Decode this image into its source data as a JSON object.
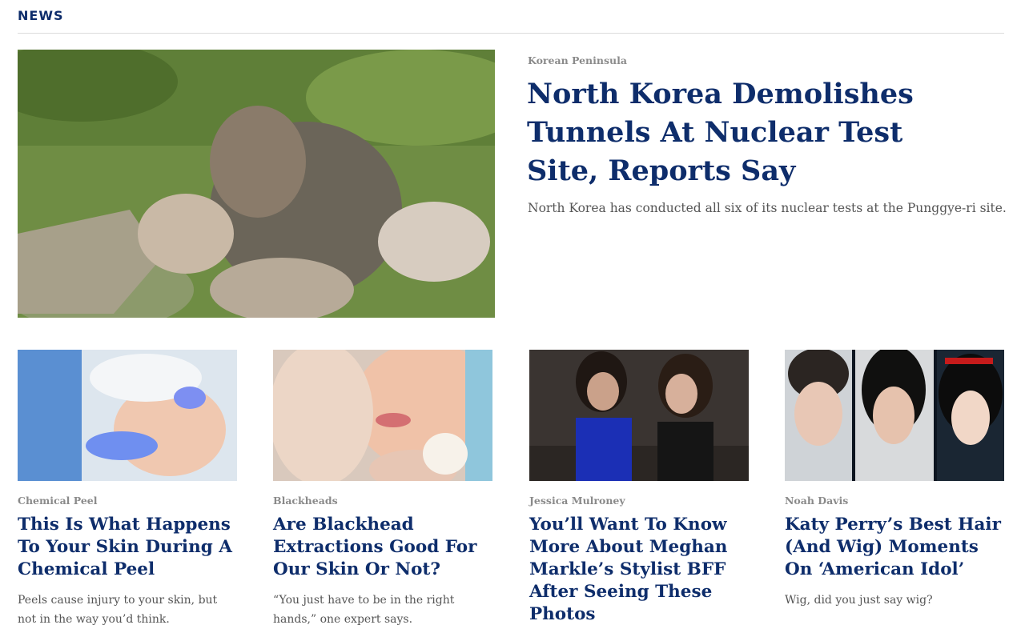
{
  "section": {
    "title": "NEWS"
  },
  "featured": {
    "kicker": "Korean Peninsula",
    "title": "North Korea Demolishes Tunnels At Nuclear Test Site, Reports Say",
    "description": "North Korea has conducted all six of its nuclear tests at the Punggye-ri site."
  },
  "cards": [
    {
      "kicker": "Chemical Peel",
      "title": "This Is What Happens To Your Skin During A Chemical Peel",
      "description": "Peels cause injury to your skin, but not in the way you’d think."
    },
    {
      "kicker": "Blackheads",
      "title": "Are Blackhead Extractions Good For Our Skin Or Not?",
      "description": "“You just have to be in the right hands,” one expert says."
    },
    {
      "kicker": "Jessica Mulroney",
      "title": "You’ll Want To Know More About Meghan Markle’s Stylist BFF After Seeing These Photos",
      "description": ""
    },
    {
      "kicker": "Noah Davis",
      "title": "Katy Perry’s Best Hair (And Wig) Moments On ‘American Idol’",
      "description": "Wig, did you just say wig?"
    }
  ]
}
